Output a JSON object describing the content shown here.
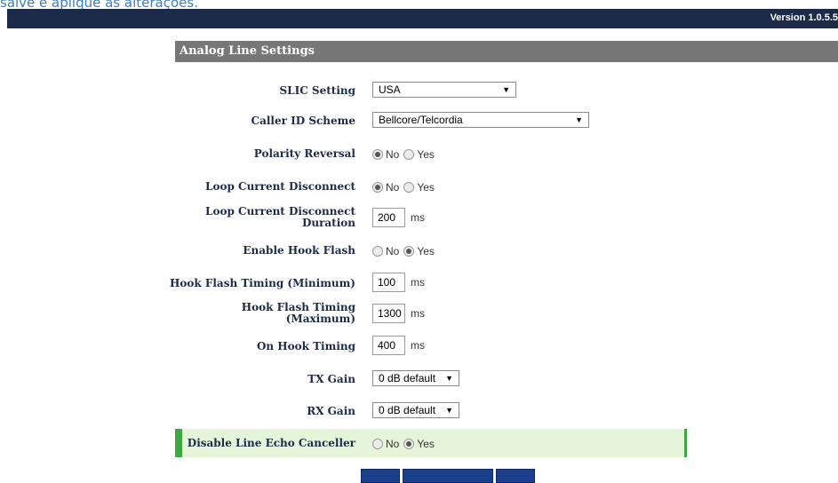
{
  "top_caption": "salve e aplique as alterações.",
  "version": "Version 1.0.5.5",
  "panel_title": "Analog Line Settings",
  "settings": {
    "slic": {
      "label": "SLIC Setting",
      "value": "USA"
    },
    "caller_id": {
      "label": "Caller ID Scheme",
      "value": "Bellcore/Telcordia"
    },
    "polarity": {
      "label": "Polarity Reversal",
      "no": "No",
      "yes": "Yes",
      "selected": "No"
    },
    "loop_disconnect": {
      "label": "Loop Current Disconnect",
      "no": "No",
      "yes": "Yes",
      "selected": "No"
    },
    "loop_duration": {
      "label_line1": "Loop Current Disconnect",
      "label_line2": "Duration",
      "value": "200",
      "unit": "ms"
    },
    "hook_flash": {
      "label": "Enable Hook Flash",
      "no": "No",
      "yes": "Yes",
      "selected": "Yes"
    },
    "hook_min": {
      "label": "Hook Flash Timing (Minimum)",
      "value": "100",
      "unit": "ms"
    },
    "hook_max": {
      "label_line1": "Hook Flash Timing",
      "label_line2": "(Maximum)",
      "value": "1300",
      "unit": "ms"
    },
    "on_hook": {
      "label": "On Hook Timing",
      "value": "400",
      "unit": "ms"
    },
    "tx_gain": {
      "label": "TX Gain",
      "value": "0 dB default"
    },
    "rx_gain": {
      "label": "RX Gain",
      "value": "0 dB default"
    },
    "echo": {
      "label": "Disable Line Echo Canceller",
      "no": "No",
      "yes": "Yes",
      "selected": "Yes"
    }
  },
  "colors": {
    "top_bar": "#1c2b49",
    "panel_header": "#777777",
    "highlight_bg": "#e6f4da",
    "highlight_border": "#3da842",
    "button": "#1c3f8c"
  }
}
